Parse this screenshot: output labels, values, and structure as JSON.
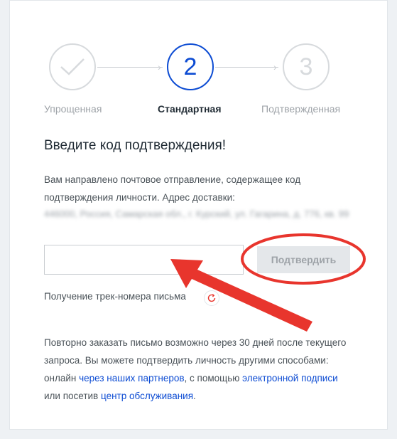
{
  "stepper": {
    "steps": [
      {
        "label": "Упрощенная",
        "state": "done",
        "number": ""
      },
      {
        "label": "Стандартная",
        "state": "active",
        "number": "2"
      },
      {
        "label": "Подтвержденная",
        "state": "future",
        "number": "3"
      }
    ]
  },
  "form": {
    "heading": "Введите код подтверждения!",
    "intro": "Вам направлено почтовое отправление, содержащее код подтверждения личности. Адрес доставки:",
    "address_blurred": "446000, Россия, Самарская обл., г. Курский, ул. Гагарина, д. 776, кв. 99",
    "code_value": "",
    "code_placeholder": "",
    "confirm_label": "Подтвердить",
    "track_label": "Получение трек-номера письма"
  },
  "footer": {
    "text_1": "Повторно заказать письмо возможно через 30 дней после текущего запроса. Вы можете подтвердить личность другими способами: онлайн ",
    "link_partners": "через наших партнеров",
    "text_2": ", с помощью ",
    "link_signature": "электронной подписи",
    "text_3": " или посетив ",
    "link_center": "центр обслуживания",
    "text_4": "."
  },
  "colors": {
    "accent": "#0d4cd3",
    "annotation_red": "#e8352d",
    "disabled_button_bg": "#e4e7ea"
  },
  "icons": {
    "step_done": "checkmark-icon",
    "refresh": "refresh-icon",
    "connector": "arrow-right-icon"
  }
}
